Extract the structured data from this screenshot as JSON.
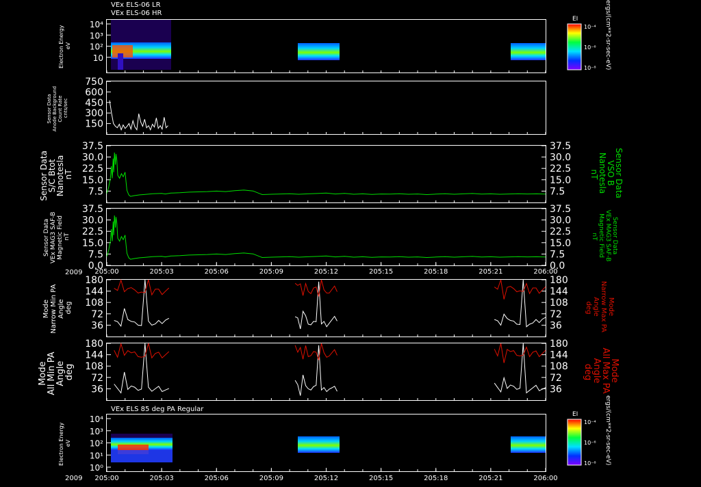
{
  "colors": {
    "background": "#000000",
    "axis": "#ffffff",
    "white_trace": "#ffffff",
    "green_trace": "#00e000",
    "red_trace": "#e01000"
  },
  "titles": {
    "top_lr": "VEx ELS-06 LR",
    "top_hr": "VEx ELS-06 HR",
    "bottom": "VEx ELS 85 deg PA Regular"
  },
  "time_axis": {
    "year": "2009",
    "ticks": [
      "205:00",
      "205:03",
      "205:06",
      "205:09",
      "205:12",
      "205:15",
      "205:18",
      "205:21",
      "206:00"
    ]
  },
  "colorbars": {
    "label": "EI",
    "units": "ergs/(cm**2-sr-sec-eV)",
    "ticks": [
      "10⁻⁴",
      "10⁻⁶",
      "10⁻⁸"
    ]
  },
  "chart_data": [
    {
      "type": "heatmap",
      "ylabel": [
        "Electron Energy",
        "eV"
      ],
      "yscale": "log",
      "yticks": [
        "10⁴",
        "10³",
        "10²",
        "10",
        ""
      ],
      "data_intervals": [
        "205:00–205:03",
        "205:10–205:12",
        "205:21–206:00"
      ]
    },
    {
      "type": "line",
      "ylabel": [
        "Sensor Data",
        "Anode Background",
        "Count Rate",
        "cnts/sec"
      ],
      "ylim": [
        0,
        750
      ],
      "yticks": [
        "750",
        "600",
        "450",
        "300",
        "150"
      ],
      "values": [
        480,
        300,
        150,
        110,
        90,
        140,
        60,
        130,
        80,
        110,
        150,
        70,
        190,
        100,
        60,
        290,
        170,
        110,
        210,
        90,
        120,
        60,
        140,
        100,
        230,
        80,
        120,
        70,
        240,
        90,
        120
      ]
    },
    {
      "type": "line",
      "ylabel": [
        "Sensor Data",
        "S/C Btot",
        "Nanotesla",
        "nT"
      ],
      "ylabel_right": [
        "Sensor Data",
        "VSO B",
        "Nanotesla",
        "nT"
      ],
      "ylim": [
        0,
        37.5
      ],
      "yticks": [
        "37.5",
        "30.0",
        "22.5",
        "15.0",
        "7.5"
      ],
      "series": [
        {
          "x": [
            0,
            0.1,
            0.2,
            0.25,
            0.3,
            0.35,
            0.38,
            0.42,
            0.47,
            0.5,
            0.55,
            0.6,
            0.7,
            0.8,
            0.9,
            1.0,
            1.1,
            1.2,
            1.3,
            1.5,
            1.8,
            2.0,
            2.5,
            3.0,
            3.2,
            3.5,
            4.0,
            4.5,
            5.0,
            5.5,
            6.0,
            6.5,
            7.0,
            7.5,
            8.0,
            8.5,
            9.0,
            9.5,
            10.0,
            10.5,
            11.0,
            11.5,
            12.0,
            12.5,
            13.0,
            13.5,
            14.0,
            14.5,
            15.0,
            15.5,
            16.0,
            16.5,
            17.0,
            17.5,
            18.0,
            18.5,
            19.0,
            19.5,
            20.0,
            20.5,
            21.0,
            21.5,
            22.0,
            22.5,
            23.0,
            23.5,
            24.0
          ],
          "values": [
            6,
            10,
            16,
            24,
            16,
            29,
            20,
            33,
            25,
            32,
            28,
            18,
            16,
            19,
            17,
            20,
            8,
            5,
            4,
            4.5,
            5,
            5.2,
            5.8,
            6,
            5.6,
            6.2,
            6.4,
            6.8,
            7,
            7.2,
            7.5,
            7.2,
            7.8,
            8.2,
            7.6,
            5.2,
            5.4,
            5.6,
            5.8,
            5.4,
            5.7,
            5.9,
            6.2,
            5.6,
            6,
            5.4,
            5.7,
            5.3,
            5.6,
            5.5,
            5.8,
            5.4,
            5.6,
            5.2,
            5.5,
            5.8,
            5.4,
            5.7,
            5.9,
            5.5,
            5.7,
            5.4,
            5.6,
            5.8,
            5.6,
            5.7,
            5.5
          ]
        }
      ]
    },
    {
      "type": "line",
      "ylabel": [
        "Sensor Data",
        "VEx MAG3 SAF-B",
        "Magnetic Field",
        "nT"
      ],
      "ylabel_right": [
        "Sensor Data",
        "VEx MAG3 SAF-B",
        "Magnetic Field",
        "nT"
      ],
      "ylim": [
        0,
        37.5
      ],
      "yticks": [
        "37.5",
        "30.0",
        "22.5",
        "15.0",
        "7.5",
        "0.0"
      ],
      "series": [
        {
          "x": [
            0,
            0.1,
            0.2,
            0.25,
            0.3,
            0.35,
            0.38,
            0.42,
            0.47,
            0.5,
            0.55,
            0.6,
            0.7,
            0.8,
            0.9,
            1.0,
            1.1,
            1.2,
            1.3,
            1.5,
            1.8,
            2.0,
            2.5,
            3.0,
            3.2,
            3.5,
            4.0,
            4.5,
            5.0,
            5.5,
            6.0,
            6.5,
            7.0,
            7.5,
            8.0,
            8.5,
            9.0,
            9.5,
            10.0,
            10.5,
            11.0,
            11.5,
            12.0,
            12.5,
            13.0,
            13.5,
            14.0,
            14.5,
            15.0,
            15.5,
            16.0,
            16.5,
            17.0,
            17.5,
            18.0,
            18.5,
            19.0,
            19.5,
            20.0,
            20.5,
            21.0,
            21.5,
            22.0,
            22.5,
            23.0,
            23.5,
            24.0
          ],
          "values": [
            6,
            10,
            16,
            24,
            16,
            29,
            20,
            33,
            25,
            32,
            28,
            18,
            16,
            19,
            17,
            20,
            8,
            5,
            4,
            4.5,
            5,
            5.2,
            5.8,
            6,
            5.6,
            6.2,
            6.4,
            6.8,
            7,
            7.2,
            7.5,
            7.2,
            7.8,
            8.2,
            7.6,
            5.2,
            5.4,
            5.6,
            5.8,
            5.4,
            5.7,
            5.9,
            6.2,
            5.6,
            6,
            5.4,
            5.7,
            5.3,
            5.6,
            5.5,
            5.8,
            5.4,
            5.6,
            5.2,
            5.5,
            5.8,
            5.4,
            5.7,
            5.9,
            5.5,
            5.7,
            5.4,
            5.6,
            5.8,
            5.6,
            5.7,
            5.5
          ]
        }
      ]
    },
    {
      "type": "line",
      "ylabel": [
        "Mode",
        "Narrow Min PA",
        "Angle",
        "deg"
      ],
      "ylabel_right": [
        "Mode",
        "Narrow Max PA",
        "Angle",
        "deg"
      ],
      "ylim": [
        0,
        180
      ],
      "yticks": [
        "180",
        "144",
        "108",
        "72",
        "36"
      ],
      "series": [
        {
          "values": [
            60,
            50,
            30,
            80,
            60,
            48,
            40,
            45,
            38,
            180,
            40,
            42,
            40,
            45,
            50,
            55,
            55
          ]
        },
        {
          "values": [
            165,
            150,
            175,
            130,
            160,
            155,
            140,
            150,
            145,
            135,
            180,
            140,
            150,
            142,
            145,
            148,
            150
          ]
        }
      ]
    },
    {
      "type": "line",
      "ylabel": [
        "Mode",
        "All Min PA",
        "Angle",
        "deg"
      ],
      "ylabel_right": [
        "Mode",
        "All Max PA",
        "Angle",
        "deg"
      ],
      "ylim": [
        0,
        180
      ],
      "yticks": [
        "180",
        "144",
        "108",
        "72",
        "36"
      ],
      "series": [
        {
          "values": [
            60,
            40,
            20,
            80,
            40,
            45,
            35,
            40,
            38,
            180,
            32,
            34,
            36,
            38,
            36,
            35,
            34
          ]
        },
        {
          "values": [
            170,
            140,
            175,
            130,
            165,
            150,
            145,
            150,
            140,
            135,
            180,
            142,
            148,
            144,
            146,
            148,
            150
          ]
        }
      ]
    },
    {
      "type": "heatmap",
      "ylabel": [
        "Electron Energy",
        "eV"
      ],
      "yscale": "log",
      "yticks": [
        "10⁴",
        "10³",
        "10²",
        "10¹",
        "10⁰"
      ],
      "data_intervals": [
        "205:00–205:03",
        "205:10–205:12",
        "205:21–206:00"
      ]
    }
  ]
}
